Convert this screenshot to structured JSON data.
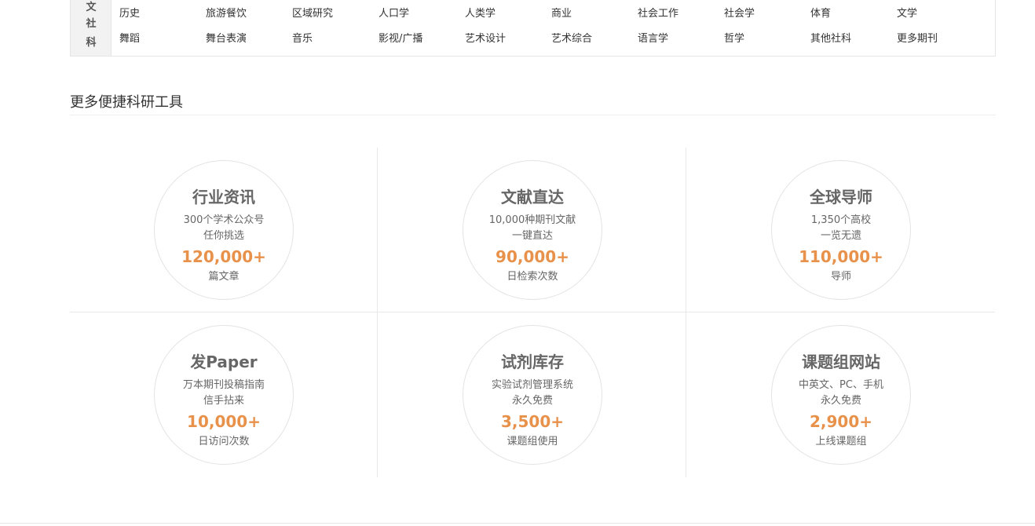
{
  "category": {
    "label_chars": [
      "文",
      "社",
      "科"
    ],
    "rows": [
      [
        "历史",
        "旅游餐饮",
        "区域研究",
        "人口学",
        "人类学",
        "商业",
        "社会工作",
        "社会学",
        "体育",
        "文学"
      ],
      [
        "舞蹈",
        "舞台表演",
        "音乐",
        "影视/广播",
        "艺术设计",
        "艺术综合",
        "语言学",
        "哲学",
        "其他社科",
        "更多期刊"
      ]
    ]
  },
  "tools_section": {
    "title": "更多便捷科研工具",
    "items": [
      {
        "title": "行业资讯",
        "line1": "300个学术公众号",
        "line2": "任你挑选",
        "number": "120,000+",
        "unit": "篇文章"
      },
      {
        "title": "文献直达",
        "line1": "10,000种期刊文献",
        "line2": "一键直达",
        "number": "90,000+",
        "unit": "日检索次数"
      },
      {
        "title": "全球导师",
        "line1": "1,350个高校",
        "line2": "一览无遗",
        "number": "110,000+",
        "unit": "导师"
      },
      {
        "title": "发Paper",
        "line1": "万本期刊投稿指南",
        "line2": "信手拈来",
        "number": "10,000+",
        "unit": "日访问次数"
      },
      {
        "title": "试剂库存",
        "line1": "实验试剂管理系统",
        "line2": "永久免费",
        "number": "3,500+",
        "unit": "课题组使用"
      },
      {
        "title": "课题组网站",
        "line1": "中英文、PC、手机",
        "line2": "永久免费",
        "number": "2,900+",
        "unit": "上线课题组"
      }
    ]
  },
  "colors": {
    "accent": "#e8914a",
    "label_bg": "#f2f2f2",
    "border": "#e5e5e5"
  }
}
